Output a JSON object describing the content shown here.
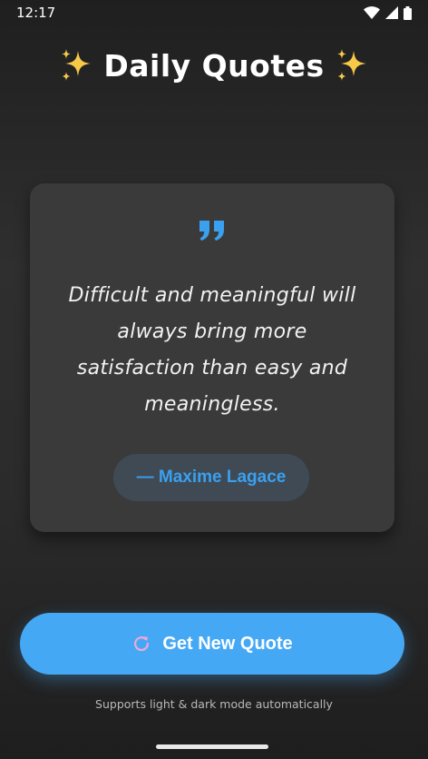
{
  "status_bar": {
    "time": "12:17",
    "icons": [
      "wifi-icon",
      "signal-icon",
      "battery-icon"
    ]
  },
  "header": {
    "title": "Daily Quotes",
    "left_icon": "sparkles-icon",
    "right_icon": "sparkles-icon"
  },
  "quote": {
    "icon": "quote-mark-icon",
    "text": "Difficult and meaningful will always bring more satisfaction than easy and meaningless.",
    "author": "— Maxime Lagace"
  },
  "actions": {
    "new_quote_label": "Get New Quote",
    "new_quote_icon": "refresh-icon"
  },
  "footer": {
    "note": "Supports light & dark mode automatically"
  },
  "colors": {
    "accent": "#45a8f5",
    "author_text": "#3aa0f0",
    "card_background": "#3a3a3a",
    "page_background": "#2b2b2b",
    "sparkle": "#f7c948"
  }
}
